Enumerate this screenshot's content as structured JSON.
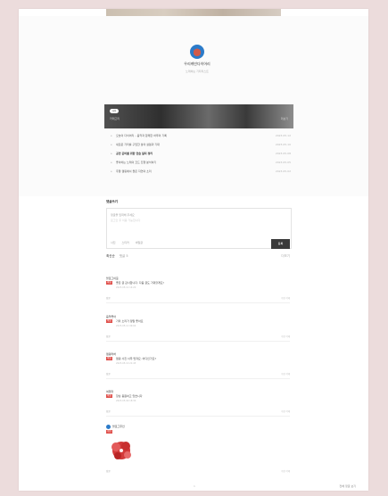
{
  "blog": {
    "name": "우리케빈다이어리",
    "subtitle": "노래하는 기타리스트"
  },
  "banner": {
    "pill": "사진",
    "left_text": "카테고리",
    "right_text": "더보기"
  },
  "posts": [
    {
      "title": "오늘의 다이어리 – 음악과 함께한 하루의 기록",
      "date": "2023.05.12"
    },
    {
      "title": "새로운 기타를 구입한 날의 설렘과 기대",
      "date": "2023.05.10"
    },
    {
      "title": "공연 준비를 위한 연습 일지 정리",
      "date": "2023.05.08"
    },
    {
      "title": "좋아하는 노래의 코드 진행 분석하기",
      "date": "2023.05.05"
    },
    {
      "title": "주말 캠핑에서 들은 자연의 소리",
      "date": "2023.05.02"
    }
  ],
  "comments": {
    "section_title": "댓글쓰기",
    "placeholder": "댓글을 입력해 주세요",
    "placeholder_hint": "로그인 후 이용 가능합니다",
    "toolbar": [
      "사진",
      "스티커",
      "비밀글"
    ],
    "submit_label": "등록",
    "sort_label": "최신순",
    "count_label": "댓글 5",
    "right_label": "더보기",
    "items": [
      {
        "author": "블로그이웃",
        "badge": "비밀",
        "text": "좋은 글 감사합니다. 다음 글도 기대할게요!",
        "date": "2023.05.12 14:20",
        "reply": "답글",
        "acts": "수정 삭제"
      },
      {
        "author": "음악좋아",
        "badge": "비밀",
        "text": "기타 소리가 정말 좋아요",
        "date": "2023.05.11 09:02",
        "reply": "답글",
        "acts": "수정 삭제"
      },
      {
        "author": "캠핑러버",
        "badge": "비밀",
        "text": "캠핑 사진 너무 멋져요. 어디인가요?",
        "date": "2023.05.10 21:45",
        "reply": "답글",
        "acts": "수정 삭제"
      },
      {
        "author": "여행자",
        "badge": "비밀",
        "text": "항상 응원하고 있습니다",
        "date": "2023.05.09 18:30",
        "reply": "답글",
        "acts": "수정 삭제"
      }
    ],
    "owner": {
      "name": "블로그주인",
      "badge": "주인",
      "reply": "답글",
      "acts": "수정 삭제"
    }
  },
  "footer": {
    "page": "1",
    "right": "전체 댓글 보기"
  }
}
